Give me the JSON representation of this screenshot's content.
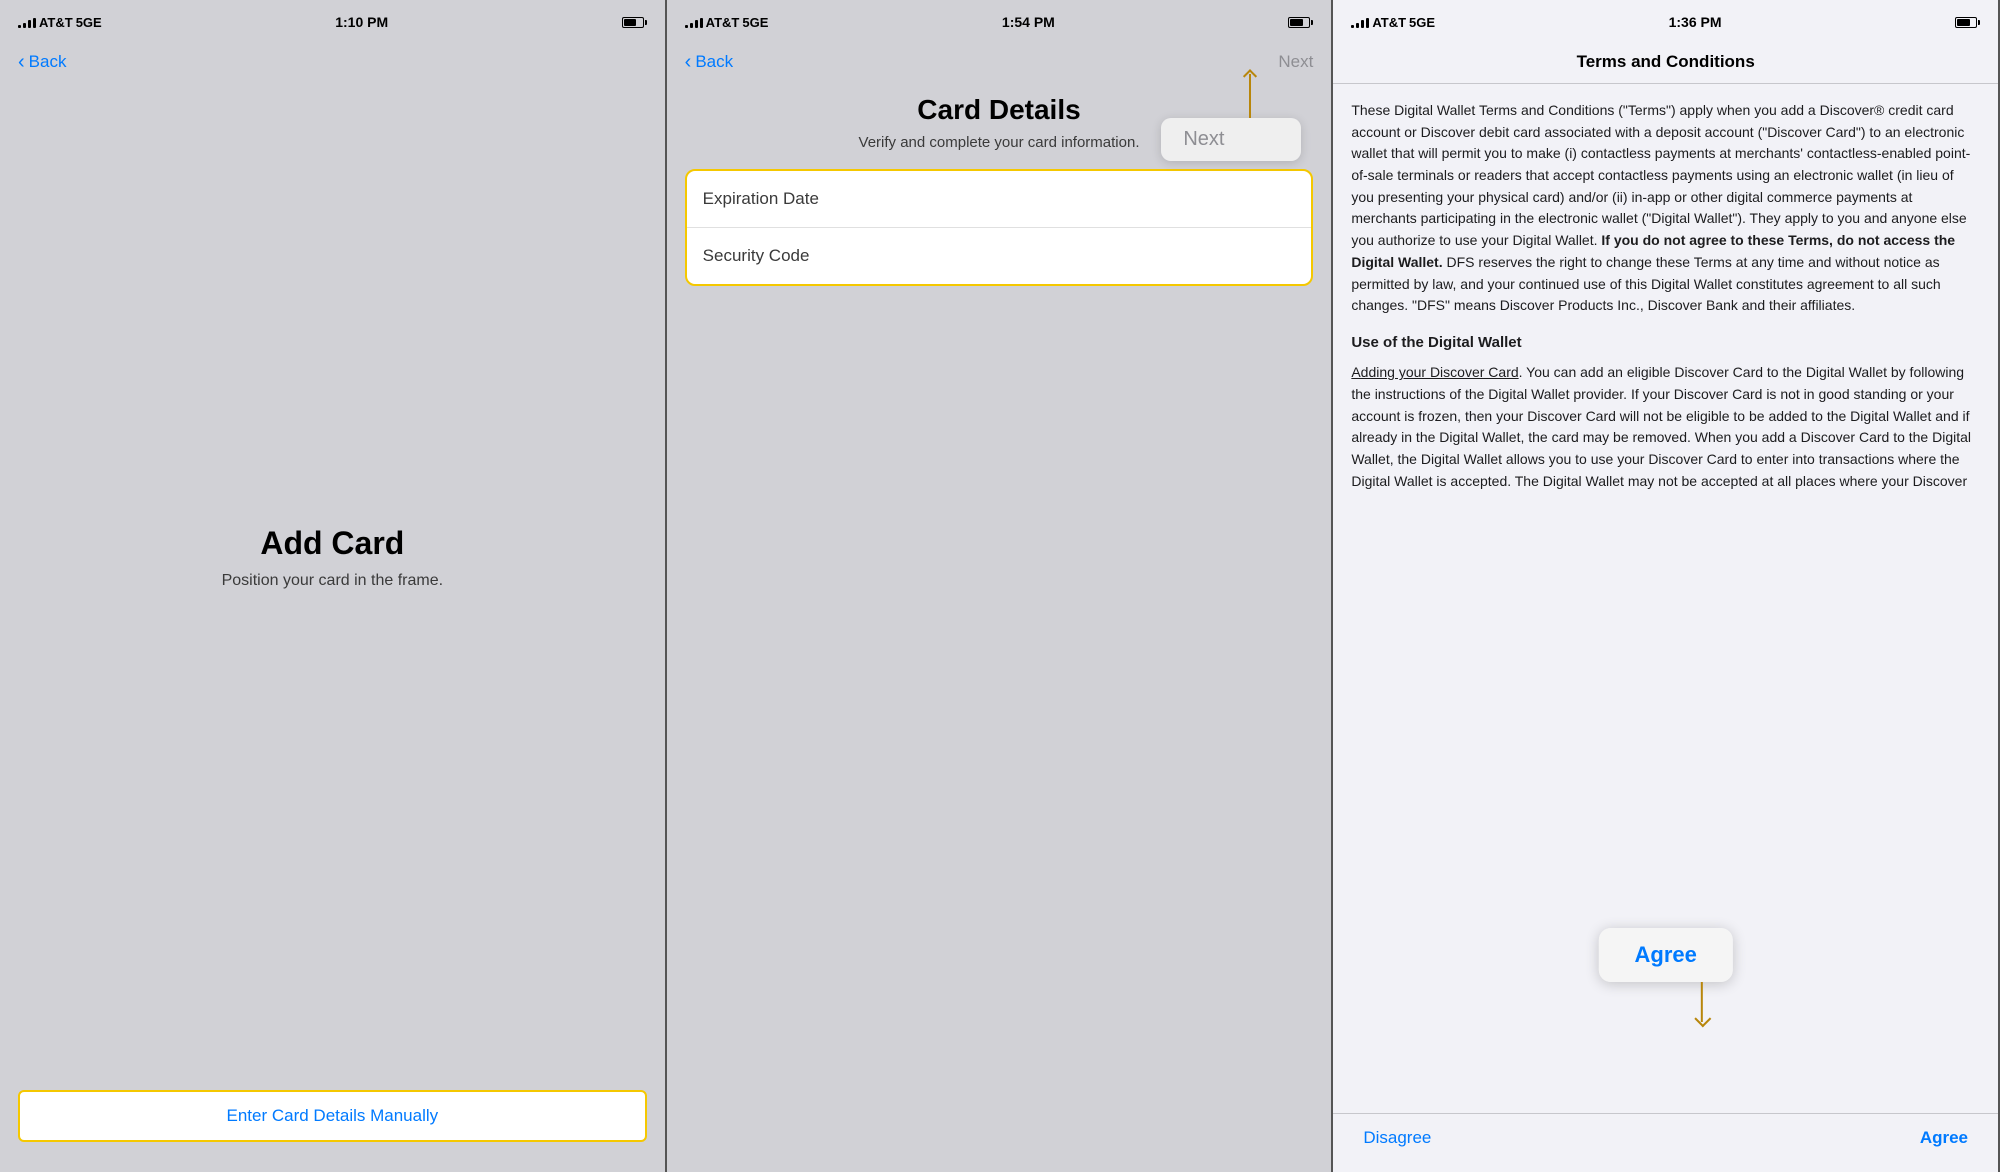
{
  "panel1": {
    "statusBar": {
      "carrier": "AT&T",
      "network": "5GE",
      "time": "1:10 PM"
    },
    "nav": {
      "backLabel": "Back"
    },
    "title": "Add Card",
    "subtitle": "Position your card in the frame.",
    "button": "Enter Card Details Manually"
  },
  "panel2": {
    "statusBar": {
      "carrier": "AT&T",
      "network": "5GE",
      "time": "1:54 PM"
    },
    "nav": {
      "backLabel": "Back",
      "nextLabel": "Next"
    },
    "title": "Card Details",
    "subtitle": "Verify and complete your card information.",
    "fields": [
      {
        "label": "Expiration Date"
      },
      {
        "label": "Security Code"
      }
    ],
    "tooltip": "Next"
  },
  "panel3": {
    "statusBar": {
      "carrier": "AT&T",
      "network": "5GE",
      "time": "1:36 PM"
    },
    "nav": {
      "title": "Terms and Conditions"
    },
    "termsIntro": "These Digital Wallet Terms and Conditions (\"Terms\") apply when you add a Discover® credit card account or Discover debit card associated with a deposit account (\"Discover Card\") to an electronic wallet that will permit you to make (i) contactless payments at merchants' contactless-enabled point-of-sale terminals or readers that accept contactless payments using an electronic wallet (in lieu of you presenting your physical card) and/or (ii) in-app or other digital commerce payments at merchants participating in the electronic wallet (\"Digital Wallet\"). They apply to you and anyone else you authorize to use your Digital Wallet.",
    "termsWarning": "If you do not agree to these Terms, do not access the Digital Wallet.",
    "termsMiddle": "DFS reserves the right to change these Terms at any time and without notice as permitted by law, and your continued use of this Digital Wallet constitutes agreement to all such changes. \"DFS\" means Discover Products Inc., Discover Bank and their affiliates.",
    "sectionHeading": "Use of the Digital Wallet",
    "termsSection2Link": "Adding your Discover Card",
    "termsSection2": ". You can add an eligible Discover Card to the Digital Wallet by following the instructions of the Digital Wallet provider. If your Discover Card is not in good standing or your account is frozen, then your Discover Card will not be eligible to be added to the Digital Wallet and if already in the Digital Wallet, the card may be removed. When you add a Discover Card to the Digital Wallet, the Digital Wallet allows you to use your Discover Card to enter into transactions where the Digital Wallet is accepted. The Digital Wallet may not be accepted at all places where your Discover",
    "agreePopover": "Agree",
    "bottomBar": {
      "disagree": "Disagree",
      "agree": "Agree"
    }
  }
}
